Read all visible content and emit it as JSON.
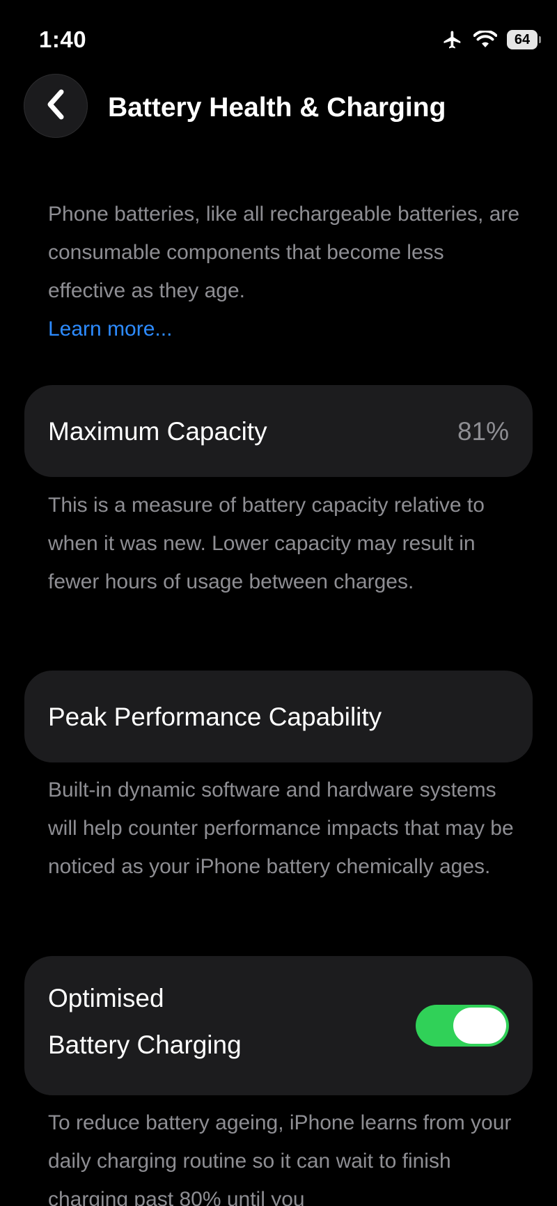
{
  "status_bar": {
    "time": "1:40",
    "battery_level": "64",
    "icons": [
      "airplane-icon",
      "wifi-icon",
      "battery-icon"
    ]
  },
  "nav": {
    "title": "Battery Health & Charging",
    "back_icon": "chevron-left-icon"
  },
  "intro": {
    "text": "Phone batteries, like all rechargeable batteries, are consumable components that become less effective as they age.",
    "learn_more": "Learn more..."
  },
  "max_capacity": {
    "label": "Maximum Capacity",
    "value": "81%",
    "footer": "This is a measure of battery capacity relative to when it was new. Lower capacity may result in fewer hours of usage between charges."
  },
  "peak_performance": {
    "label": "Peak Performance Capability",
    "footer": "Built-in dynamic software and hardware systems will help counter performance impacts that may be noticed as your iPhone battery chemically ages."
  },
  "optimised_charging": {
    "label_line1": "Optimised",
    "label_line2": "Battery Charging",
    "enabled": true,
    "footer": "To reduce battery ageing, iPhone learns from your daily charging routine so it can wait to finish charging past 80% until you"
  },
  "colors": {
    "accent_link": "#2d8bff",
    "toggle_on": "#30d158",
    "card_bg": "#1c1c1e",
    "secondary_text": "#8e8e93"
  }
}
